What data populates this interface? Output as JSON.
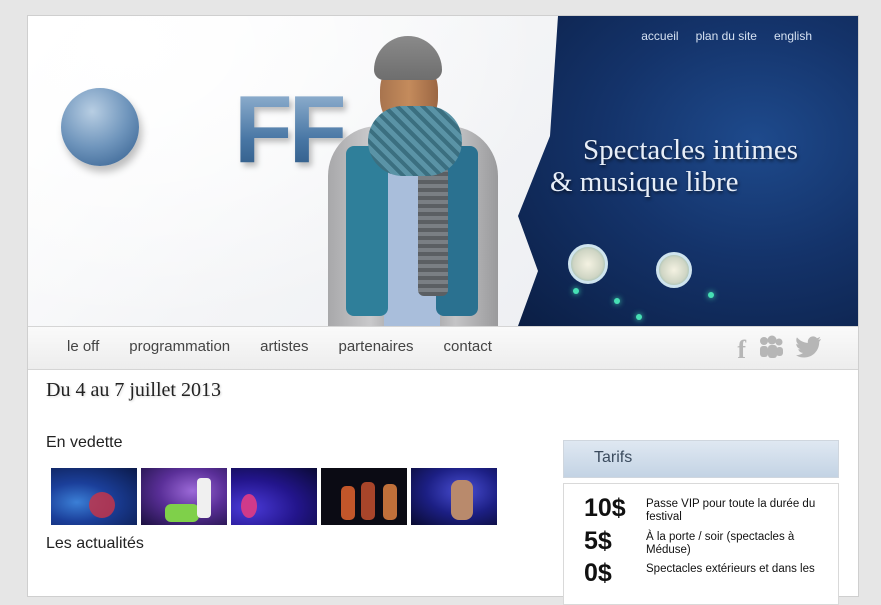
{
  "top_nav": [
    "accueil",
    "plan du site",
    "english"
  ],
  "banner": {
    "tagline_line1": "Spectacles intimes",
    "tagline_line2": "& musique libre",
    "logo_text": "FF"
  },
  "menu": [
    "le off",
    "programmation",
    "artistes",
    "partenaires",
    "contact"
  ],
  "social": {
    "facebook": "f",
    "myspace_icon": "myspace-icon",
    "twitter_icon": "twitter-icon"
  },
  "main": {
    "date_title": "Du 4 au 7 juillet 2013",
    "featured_heading": "En vedette",
    "news_heading": "Les actualités"
  },
  "tarifs": {
    "heading": "Tarifs",
    "rows": [
      {
        "price": "10$",
        "desc": "Passe VIP pour toute la durée du festival"
      },
      {
        "price": "5$",
        "desc": "À la porte / soir (spectacles à Méduse)"
      },
      {
        "price": "0$",
        "desc": "Spectacles extérieurs et dans les"
      }
    ]
  },
  "colors": {
    "accent_blue": "#14336a",
    "menu_text": "#444444"
  }
}
